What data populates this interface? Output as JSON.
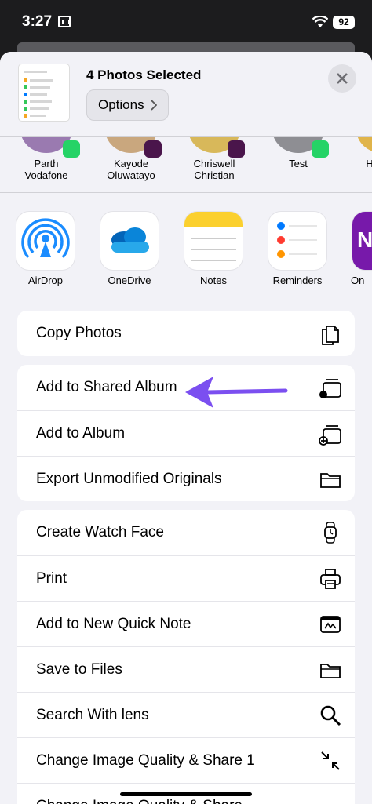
{
  "status": {
    "time": "3:27",
    "battery": "92"
  },
  "header": {
    "title": "4 Photos Selected",
    "options_label": "Options"
  },
  "people": [
    {
      "line1": "Parth",
      "line2": "Vodafone",
      "badge": "whatsapp-icon"
    },
    {
      "line1": "Kayode",
      "line2": "Oluwatayo",
      "badge": "slack-icon"
    },
    {
      "line1": "Chriswell",
      "line2": "Christian",
      "badge": "slack-icon"
    },
    {
      "line1": "Test",
      "line2": "",
      "badge": "whatsapp-icon"
    },
    {
      "line1": "H",
      "line2": ""
    }
  ],
  "apps": [
    {
      "label": "AirDrop",
      "icon": "airdrop-icon"
    },
    {
      "label": "OneDrive",
      "icon": "onedrive-icon"
    },
    {
      "label": "Notes",
      "icon": "notes-icon"
    },
    {
      "label": "Reminders",
      "icon": "reminders-icon"
    },
    {
      "label": "On",
      "icon": "onenote-icon"
    }
  ],
  "actions": {
    "group1": [
      {
        "label": "Copy Photos",
        "icon": "copy-icon"
      }
    ],
    "group2": [
      {
        "label": "Add to Shared Album",
        "icon": "shared-album-icon"
      },
      {
        "label": "Add to Album",
        "icon": "add-album-icon"
      },
      {
        "label": "Export Unmodified Originals",
        "icon": "folder-icon"
      }
    ],
    "group3": [
      {
        "label": "Create Watch Face",
        "icon": "watch-icon"
      },
      {
        "label": "Print",
        "icon": "printer-icon"
      },
      {
        "label": "Add to New Quick Note",
        "icon": "quick-note-icon"
      },
      {
        "label": "Save to Files",
        "icon": "folder-icon"
      },
      {
        "label": "Search With lens",
        "icon": "search-icon"
      },
      {
        "label": "Change Image Quality & Share 1",
        "icon": "compress-icon"
      },
      {
        "label": "Change Image Quality & Share",
        "icon": ""
      }
    ]
  },
  "colors": {
    "accent_arrow": "#7b4ff0",
    "airdrop": "#1a8cff",
    "whatsapp": "#25d366",
    "onenote": "#7719aa"
  }
}
